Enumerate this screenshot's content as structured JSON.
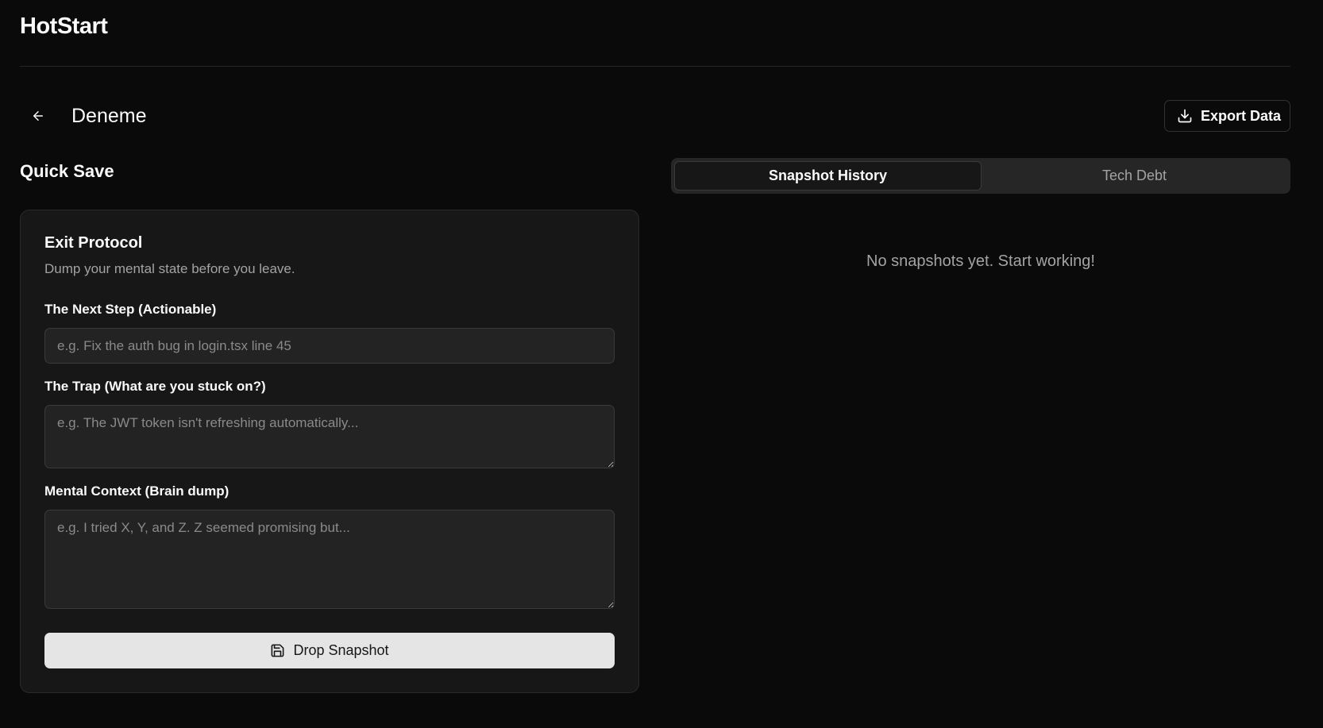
{
  "app": {
    "brand": "HotStart"
  },
  "project": {
    "title": "Deneme"
  },
  "header": {
    "export_label": "Export Data"
  },
  "quick_save": {
    "section_title": "Quick Save",
    "card_title": "Exit Protocol",
    "card_subtitle": "Dump your mental state before you leave.",
    "next_step": {
      "label": "The Next Step (Actionable)",
      "placeholder": "e.g. Fix the auth bug in login.tsx line 45",
      "value": ""
    },
    "trap": {
      "label": "The Trap (What are you stuck on?)",
      "placeholder": "e.g. The JWT token isn't refreshing automatically...",
      "value": ""
    },
    "mental_context": {
      "label": "Mental Context (Brain dump)",
      "placeholder": "e.g. I tried X, Y, and Z. Z seemed promising but...",
      "value": ""
    },
    "submit_label": "Drop Snapshot"
  },
  "tabs": [
    {
      "label": "Snapshot History",
      "active": true
    },
    {
      "label": "Tech Debt",
      "active": false
    }
  ],
  "history": {
    "empty_message": "No snapshots yet. Start working!"
  },
  "icons": {
    "back": "arrow-left-icon",
    "export": "download-icon",
    "save": "save-icon"
  },
  "colors": {
    "background": "#0a0a0a",
    "card": "#171717",
    "button_light": "#e5e5e5",
    "muted_text": "#a3a3a3"
  }
}
